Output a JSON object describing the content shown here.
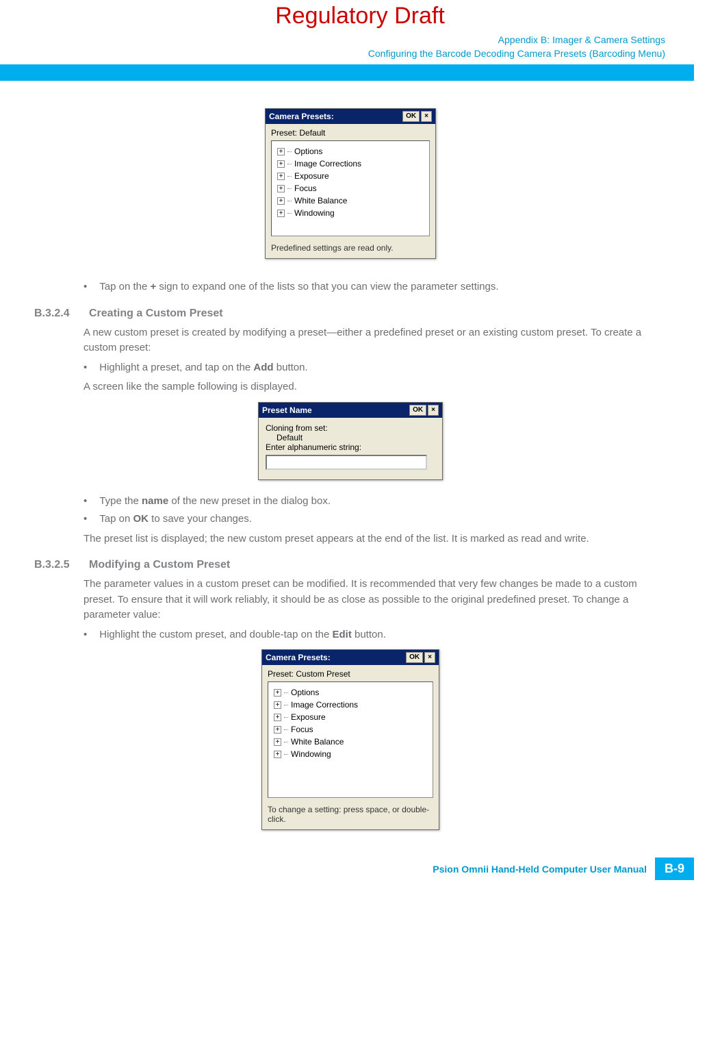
{
  "watermark": "Regulatory Draft",
  "header": {
    "line1": "Appendix B: Imager & Camera Settings",
    "line2": "Configuring the Barcode Decoding Camera Presets (Barcoding Menu)"
  },
  "dialog1": {
    "title": "Camera Presets:",
    "ok": "OK",
    "close": "×",
    "preset_label": "Preset: Default",
    "tree": [
      "Options",
      "Image Corrections",
      "Exposure",
      "Focus",
      "White Balance",
      "Windowing"
    ],
    "status": "Predefined settings are read only."
  },
  "bullet1": {
    "pre": "Tap on the ",
    "bold": "+",
    "post": " sign to expand one of the lists so that you can view the parameter settings."
  },
  "section_b324": {
    "num": "B.3.2.4",
    "title": "Creating a Custom Preset",
    "para1": "A new custom preset is created by modifying a preset—either a predefined preset or an existing custom preset. To create a custom preset:",
    "bullet_pre": "Highlight a preset, and tap on the ",
    "bullet_bold": "Add",
    "bullet_post": " button.",
    "para2": "A screen like the sample following is displayed."
  },
  "dialog2": {
    "title": "Preset Name",
    "ok": "OK",
    "close": "×",
    "line1": "Cloning from set:",
    "line2": "Default",
    "line3": "Enter alphanumeric string:"
  },
  "after_dialog2": {
    "b1_pre": "Type the ",
    "b1_bold": "name",
    "b1_post": " of the new preset in the dialog box.",
    "b2_pre": "Tap on ",
    "b2_bold": "OK",
    "b2_post": " to save your changes.",
    "para": "The preset list is displayed; the new custom preset appears at the end of the list. It is marked as read and write."
  },
  "section_b325": {
    "num": "B.3.2.5",
    "title": "Modifying a Custom Preset",
    "para": "The parameter values in a custom preset can be modified. It is recommended that very few changes be made to a custom preset. To ensure that it will work reliably, it should be as close as possible to the original predefined preset. To change a parameter value:",
    "bullet_pre": "Highlight the custom preset, and double-tap on the ",
    "bullet_bold": "Edit",
    "bullet_post": " button."
  },
  "dialog3": {
    "title": "Camera Presets:",
    "ok": "OK",
    "close": "×",
    "preset_label": "Preset: Custom Preset",
    "tree": [
      "Options",
      "Image Corrections",
      "Exposure",
      "Focus",
      "White Balance",
      "Windowing"
    ],
    "status": "To change a setting: press space, or double-click."
  },
  "footer": {
    "text": "Psion Omnii Hand-Held Computer User Manual",
    "page": "B-9"
  }
}
